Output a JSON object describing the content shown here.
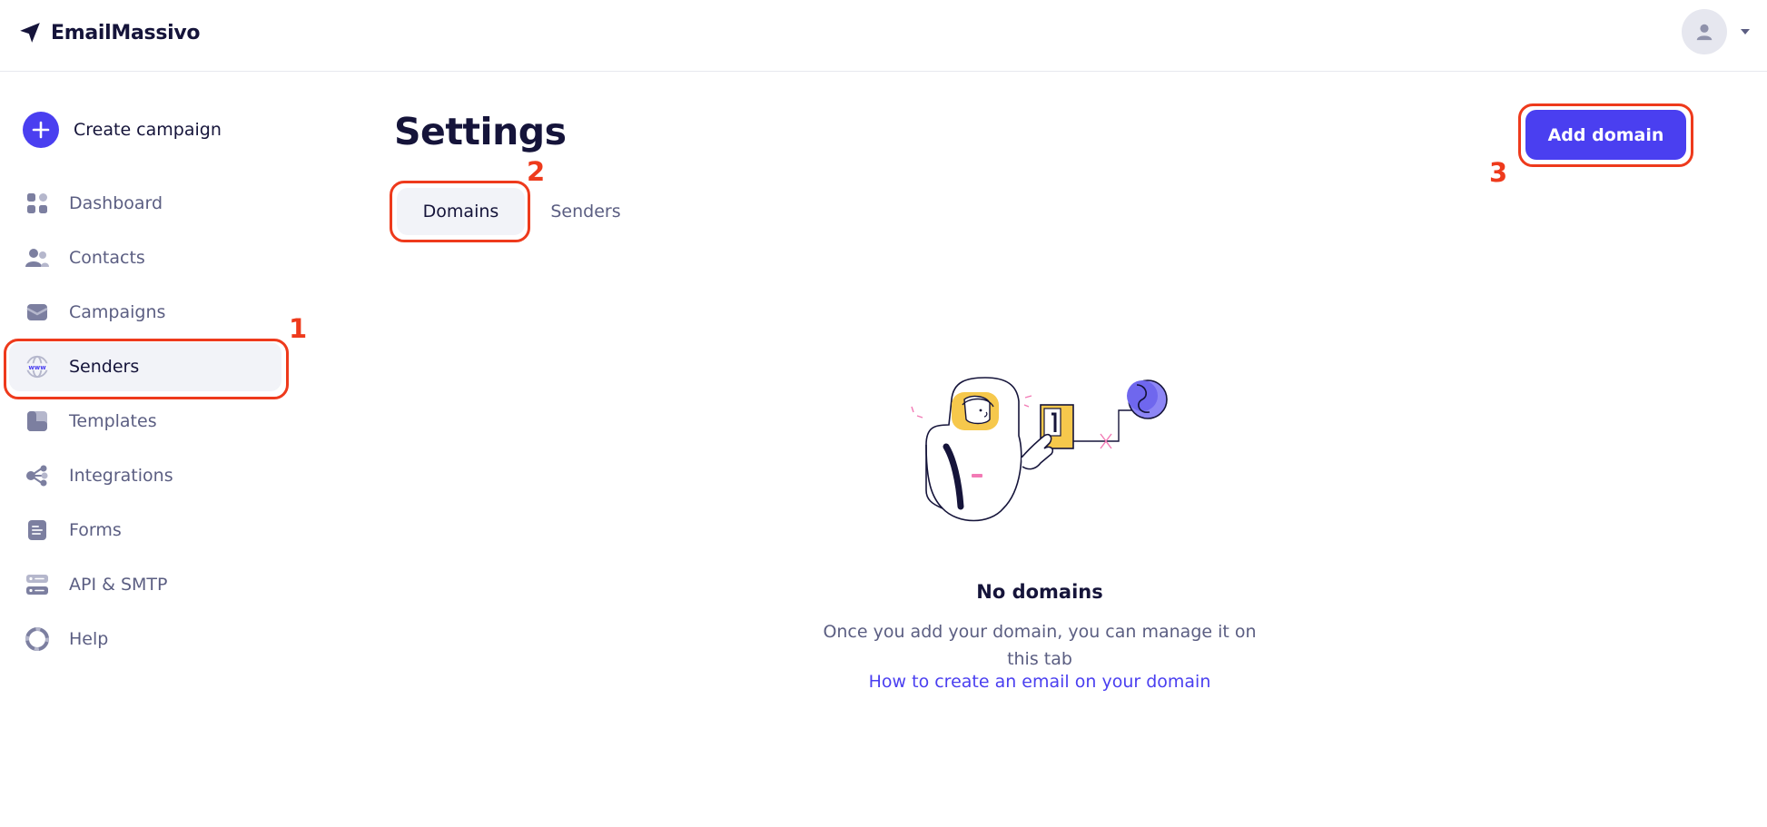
{
  "header": {
    "brand_name": "EmailMassivo",
    "logo_icon": "paper-plane-icon",
    "avatar_icon": "user-icon",
    "menu_caret_icon": "caret-down-icon"
  },
  "sidebar": {
    "create_label": "Create campaign",
    "create_icon": "plus-icon",
    "items": [
      {
        "label": "Dashboard",
        "icon": "dashboard-icon",
        "active": false
      },
      {
        "label": "Contacts",
        "icon": "contacts-icon",
        "active": false
      },
      {
        "label": "Campaigns",
        "icon": "campaigns-icon",
        "active": false
      },
      {
        "label": "Senders",
        "icon": "www-globe-icon",
        "active": true
      },
      {
        "label": "Templates",
        "icon": "templates-icon",
        "active": false
      },
      {
        "label": "Integrations",
        "icon": "integrations-icon",
        "active": false
      },
      {
        "label": "Forms",
        "icon": "forms-icon",
        "active": false
      },
      {
        "label": "API & SMTP",
        "icon": "server-icon",
        "active": false
      },
      {
        "label": "Help",
        "icon": "lifebuoy-icon",
        "active": false
      }
    ]
  },
  "main": {
    "title": "Settings",
    "tabs": [
      {
        "label": "Domains",
        "active": true
      },
      {
        "label": "Senders",
        "active": false
      }
    ],
    "add_button_label": "Add domain",
    "empty_state": {
      "title": "No domains",
      "description": "Once you add your domain, you can manage it on this tab",
      "link_text": "How to create an email on your domain",
      "illustration": "astronaut-illustration"
    }
  },
  "annotations": [
    "1",
    "2",
    "3"
  ],
  "colors": {
    "accent": "#4a3ff0",
    "annotation": "#ee3a1c",
    "text_primary": "#15143a",
    "text_secondary": "#5b5e82",
    "active_bg": "#f2f3f8"
  }
}
